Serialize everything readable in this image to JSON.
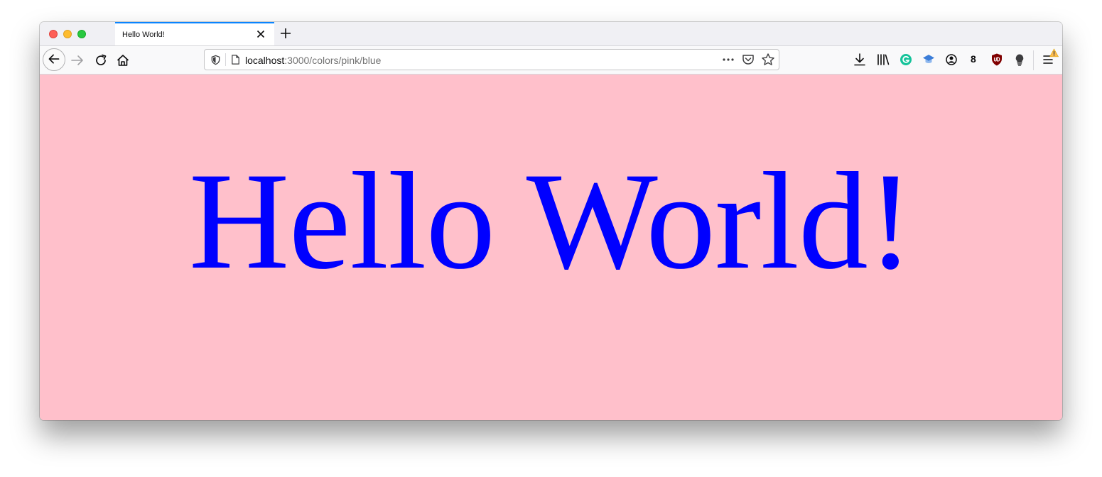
{
  "browser": {
    "tab": {
      "title": "Hello World!"
    },
    "url": {
      "host": "localhost",
      "path": ":3000/colors/pink/blue"
    },
    "toolbar": {
      "extension_count": "8"
    }
  },
  "page": {
    "heading": "Hello World!",
    "background_color": "#ffc0cb",
    "text_color": "#0000ff"
  },
  "icons": [
    "back-arrow-icon",
    "forward-arrow-icon",
    "reload-icon",
    "home-icon",
    "shield-icon",
    "page-icon",
    "more-actions-icon",
    "pocket-icon",
    "bookmark-star-icon",
    "download-icon",
    "library-icon",
    "grammarly-icon",
    "extension-cap-icon",
    "account-icon",
    "ublock-icon",
    "lightbulb-icon",
    "hamburger-menu-icon",
    "warning-icon"
  ]
}
